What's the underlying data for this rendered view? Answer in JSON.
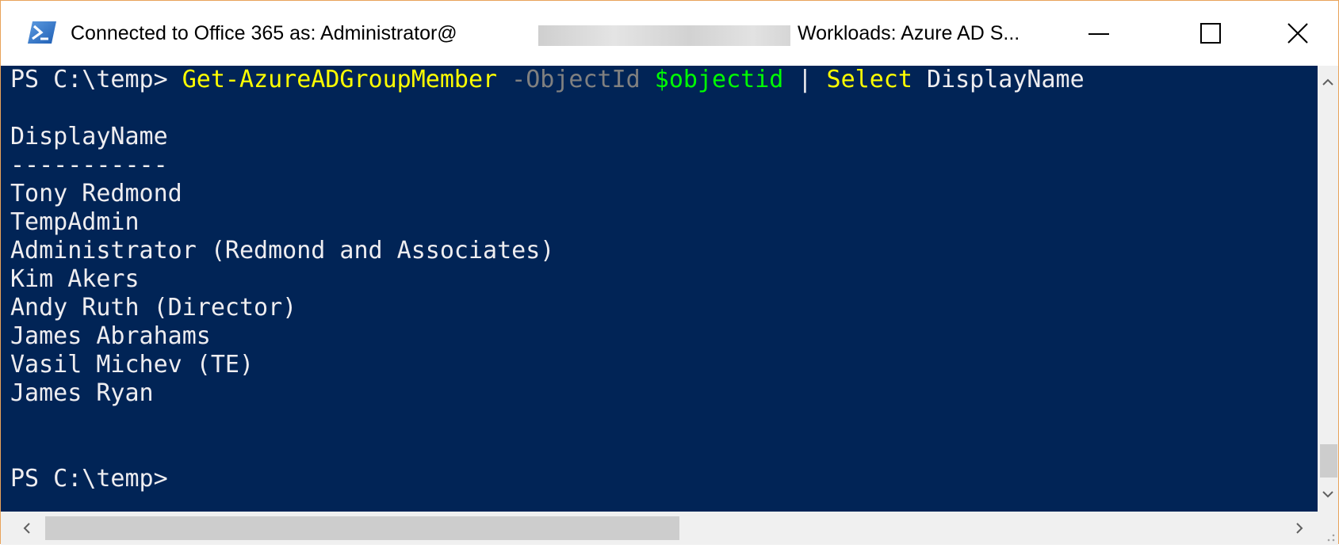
{
  "window": {
    "title_prefix": "Connected to Office 365 as: Administrator@",
    "title_suffix": "Workloads: Azure AD S...",
    "app_icon": "powershell-icon",
    "controls": {
      "minimize_icon": "minimize-icon",
      "maximize_icon": "maximize-icon",
      "close_icon": "close-icon"
    }
  },
  "console": {
    "prompt": "PS C:\\temp> ",
    "command": {
      "cmdlet": "Get-AzureADGroupMember",
      "parameter": "-ObjectId",
      "variable": "$objectid",
      "pipe": "|",
      "select_cmd": "Select",
      "select_arg": "DisplayName"
    },
    "output_header": "DisplayName",
    "output_separator": "-----------",
    "output_rows": [
      "Tony Redmond",
      "TempAdmin",
      "Administrator (Redmond and Associates)",
      "Kim Akers",
      "Andy Ruth (Director)",
      "James Abrahams",
      "Vasil Michev (TE)",
      "James Ryan"
    ],
    "final_prompt": "PS C:\\temp>"
  },
  "colors": {
    "console_bg": "#012456",
    "console_fg": "#eeedf0",
    "cmdlet": "#ffff00",
    "parameter": "#808080",
    "variable": "#00ff00",
    "window_border": "#e8a35a"
  }
}
